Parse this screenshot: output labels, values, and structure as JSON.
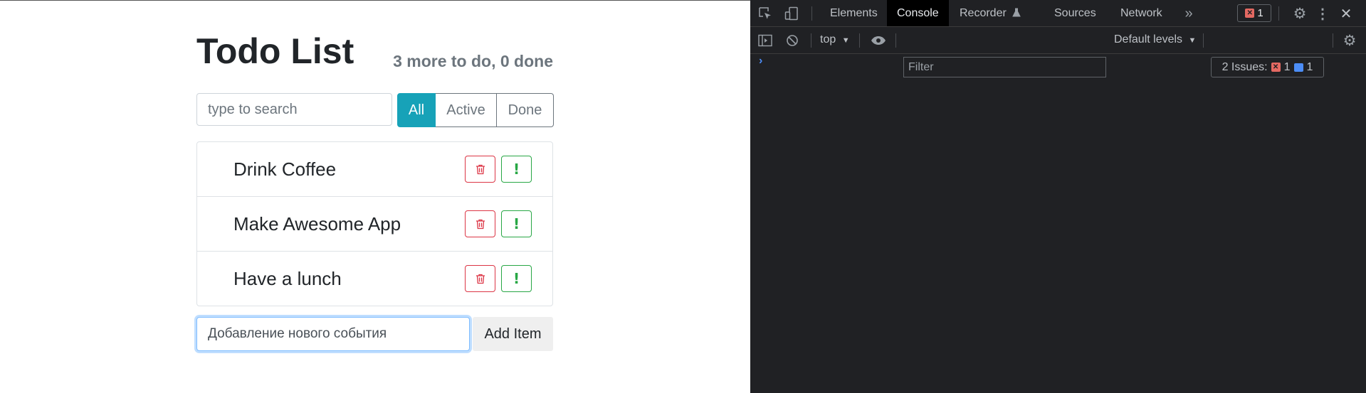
{
  "todo": {
    "title": "Todo List",
    "status": "3 more to do, 0 done",
    "search_placeholder": "type to search",
    "filters": [
      "All",
      "Active",
      "Done"
    ],
    "active_filter": "All",
    "items": [
      {
        "label": "Drink Coffee"
      },
      {
        "label": "Make Awesome App"
      },
      {
        "label": "Have a lunch"
      }
    ],
    "add_placeholder": "Добавление нового события",
    "add_button": "Add Item"
  },
  "devtools": {
    "tabs": [
      "Elements",
      "Console",
      "Recorder",
      "Sources",
      "Network"
    ],
    "active_tab": "Console",
    "error_count": "1",
    "context": "top",
    "filter_placeholder": "Filter",
    "levels": "Default levels",
    "issues_label": "2 Issues:",
    "issues_errors": "1",
    "issues_messages": "1",
    "prompt": "›"
  },
  "colors": {
    "accent": "#17a2b8",
    "danger": "#dc3545",
    "success": "#28a745",
    "devtools_bg": "#202124",
    "link_blue": "#4c8df6"
  }
}
